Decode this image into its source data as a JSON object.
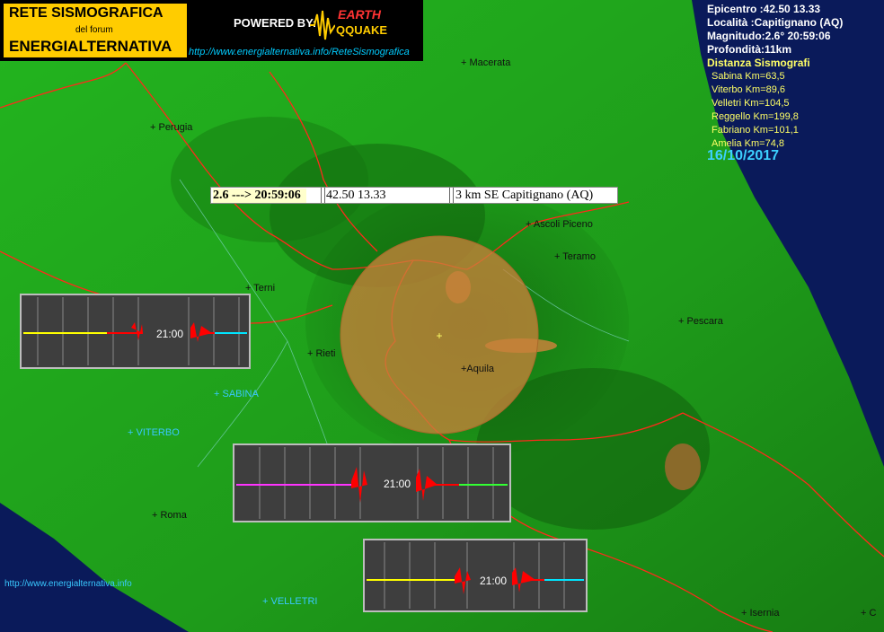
{
  "banner": {
    "title": "RETE SISMOGRAFICA",
    "subtitle": "del forum",
    "brand": "ENERGIALTERNATIVA",
    "powered": "POWERED BY:",
    "logo_earth": "EARTH",
    "logo_quake": "QQUAKE",
    "url": "http://www.energialternativa.info/ReteSismografica"
  },
  "info": {
    "epicentro": "Epicentro :42.50 13.33",
    "localita": "Località :Capitignano (AQ)",
    "magnitudo": "Magnitudo:2.6° 20:59:06",
    "profondita": "Profondità:11km",
    "distanze_title": "Distanza Sismografi",
    "distanze": [
      "Sabina Km=63,5",
      "Viterbo Km=89,6",
      "Velletri Km=104,5",
      "Reggello Km=199,8",
      "Fabriano Km=101,1",
      "Amelia Km=74,8"
    ],
    "date": "16/10/2017"
  },
  "event_bar": {
    "magnitude_time": "2.6 ---> 20:59:06",
    "coords": "42.50 13.33",
    "place": "3 km SE Capitignano (AQ)"
  },
  "cities": [
    {
      "label": "+ Macerata",
      "blue": false
    },
    {
      "label": "+ Perugia",
      "blue": false
    },
    {
      "label": "+ Ascoli Piceno",
      "blue": false
    },
    {
      "label": "+ Teramo",
      "blue": false
    },
    {
      "label": "+ Terni",
      "blue": false
    },
    {
      "label": "+ Pescara",
      "blue": false
    },
    {
      "label": "+ Rieti",
      "blue": false
    },
    {
      "label": "+Aquila",
      "blue": false
    },
    {
      "label": "+ SABINA",
      "blue": true
    },
    {
      "label": "+ VITERBO",
      "blue": true
    },
    {
      "label": "+ Roma",
      "blue": false
    },
    {
      "label": "+ VELLETRI",
      "blue": true
    },
    {
      "label": "+ Isernia",
      "blue": false
    },
    {
      "label": "+ C",
      "blue": false
    }
  ],
  "footer_url": "http://www.energialternativa.info",
  "seismograms": [
    {
      "time": "21:00",
      "colors": [
        "#ffff00",
        "#ff0000",
        "#00e5ff"
      ]
    },
    {
      "time": "21:00",
      "colors": [
        "#ff33ff",
        "#ff0000",
        "#33ff33"
      ]
    },
    {
      "time": "21:00",
      "colors": [
        "#ffff00",
        "#ff0000",
        "#00e5ff"
      ]
    }
  ],
  "colors": {
    "land": "#1faa1a",
    "sea": "#0a1a5a",
    "epicenter": "#c8823a",
    "border": "#ff2a1a"
  }
}
